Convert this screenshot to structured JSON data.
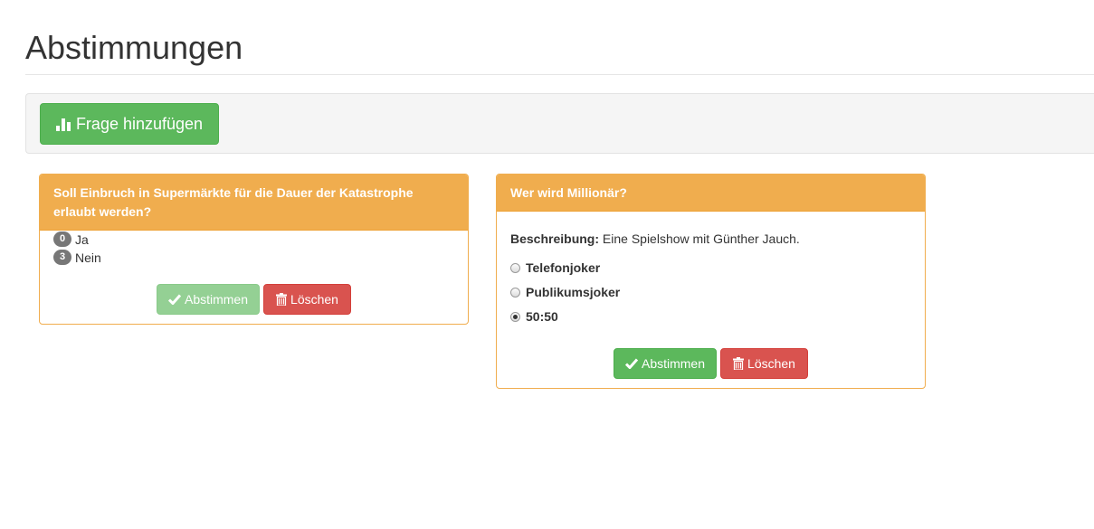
{
  "page": {
    "title": "Abstimmungen"
  },
  "toolbar": {
    "add_button_label": "Frage hinzufügen",
    "add_icon": "bar-chart-icon"
  },
  "polls": [
    {
      "question": "Soll Einbruch in Supermärkte für die Dauer der Katastrophe erlaubt werden?",
      "answers": [
        {
          "count": "0",
          "label": "Ja"
        },
        {
          "count": "3",
          "label": "Nein"
        }
      ],
      "vote_label": "Abstimmen",
      "vote_disabled": true,
      "delete_label": "Löschen"
    },
    {
      "question": "Wer wird Millionär?",
      "description_label": "Beschreibung:",
      "description": "Eine Spielshow mit Günther Jauch.",
      "options": [
        {
          "label": "Telefonjoker",
          "checked": false
        },
        {
          "label": "Publikumsjoker",
          "checked": false
        },
        {
          "label": "50:50",
          "checked": true
        }
      ],
      "vote_label": "Abstimmen",
      "vote_disabled": false,
      "delete_label": "Löschen"
    }
  ],
  "colors": {
    "success": "#5cb85c",
    "danger": "#d9534f",
    "warning": "#f0ad4e",
    "badge": "#777777"
  }
}
